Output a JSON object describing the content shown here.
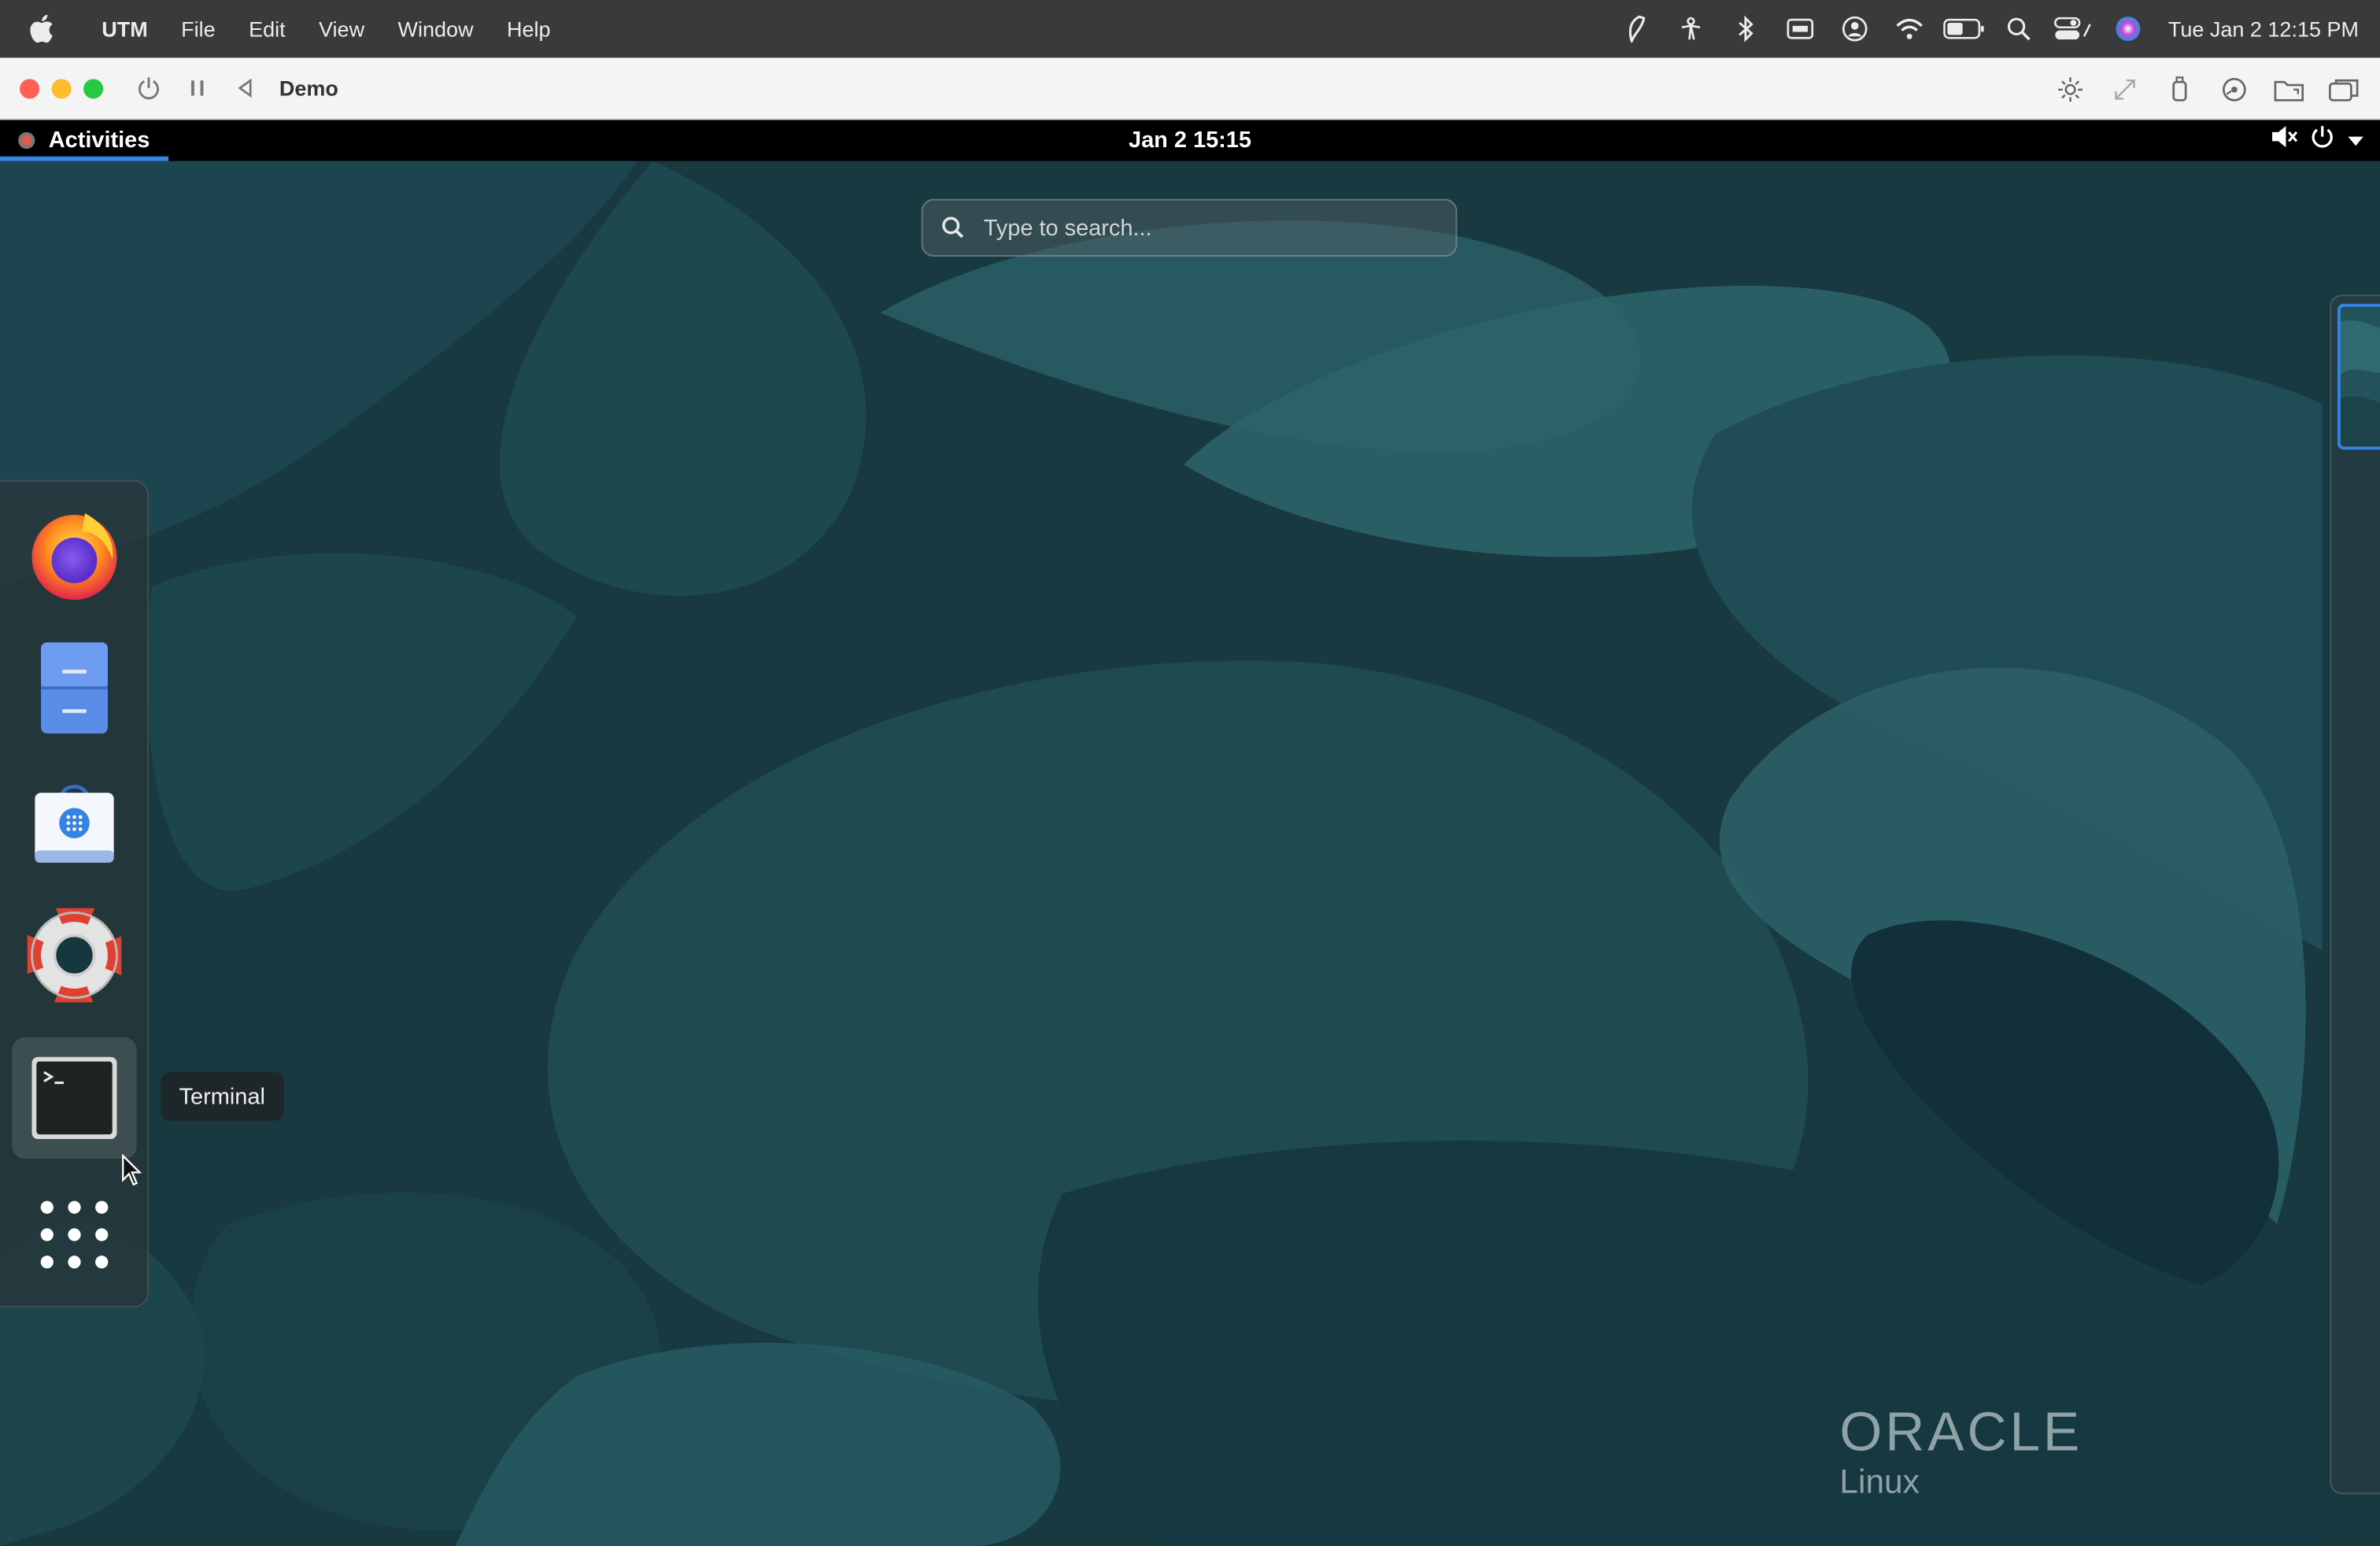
{
  "mac_menubar": {
    "app_name": "UTM",
    "menus": [
      "File",
      "Edit",
      "View",
      "Window",
      "Help"
    ],
    "clock": "Tue Jan 2  12:15 PM"
  },
  "utm_window": {
    "title": "Demo"
  },
  "gnome": {
    "activities_label": "Activities",
    "clock": "Jan 2  15:15"
  },
  "search": {
    "placeholder": "Type to search..."
  },
  "dash": {
    "tooltip": "Terminal",
    "apps": [
      "firefox-icon",
      "files-icon",
      "software-icon",
      "help-icon",
      "terminal-icon",
      "show-apps-icon"
    ]
  },
  "wallpaper": {
    "logo_text": "ORACLE",
    "logo_subtext": "Linux"
  },
  "colors": {
    "accent": "#3584e4",
    "wallpaper_base": "#16373d"
  }
}
